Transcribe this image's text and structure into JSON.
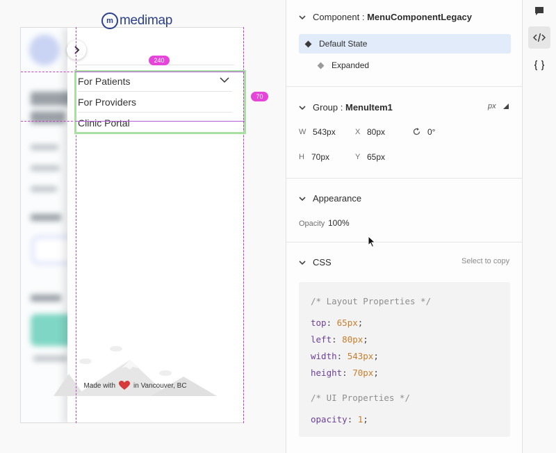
{
  "canvas": {
    "logo_text": "medimap",
    "logo_mark": "m",
    "menu_items": [
      "For Patients",
      "For Providers",
      "Clinic Portal"
    ],
    "measure_width": "240",
    "measure_height": "70",
    "footer_made_with": "Made with",
    "footer_location": "in Vancouver, BC",
    "colors": {
      "guide": "#c040c0",
      "selection": "#a7e0a1",
      "pill": "#e545d8",
      "heart": "#d63a3a",
      "brand": "#2b3f8f"
    }
  },
  "inspector": {
    "component_label": "Component :",
    "component_name": "MenuComponentLegacy",
    "states": [
      {
        "label": "Default State",
        "selected": true
      },
      {
        "label": "Expanded",
        "selected": false
      }
    ],
    "group_label": "Group :",
    "group_name": "MenuItem1",
    "unit": "px",
    "props": {
      "w_label": "W",
      "w_value": "543px",
      "x_label": "X",
      "x_value": "80px",
      "rotation_value": "0°",
      "h_label": "H",
      "h_value": "70px",
      "y_label": "Y",
      "y_value": "65px"
    },
    "appearance_title": "Appearance",
    "opacity_label": "Opacity",
    "opacity_value": "100%",
    "css_title": "CSS",
    "select_to_copy": "Select to copy",
    "css_code": {
      "layout_comment": "/* Layout Properties */",
      "top": {
        "prop": "top",
        "value": "65px"
      },
      "left": {
        "prop": "left",
        "value": "80px"
      },
      "width": {
        "prop": "width",
        "value": "543px"
      },
      "height": {
        "prop": "height",
        "value": "70px"
      },
      "ui_comment": "/* UI Properties */",
      "opacity": {
        "prop": "opacity",
        "value": "1"
      }
    }
  },
  "rail": {
    "icons": [
      "comment-icon",
      "code-icon",
      "braces-icon"
    ]
  }
}
